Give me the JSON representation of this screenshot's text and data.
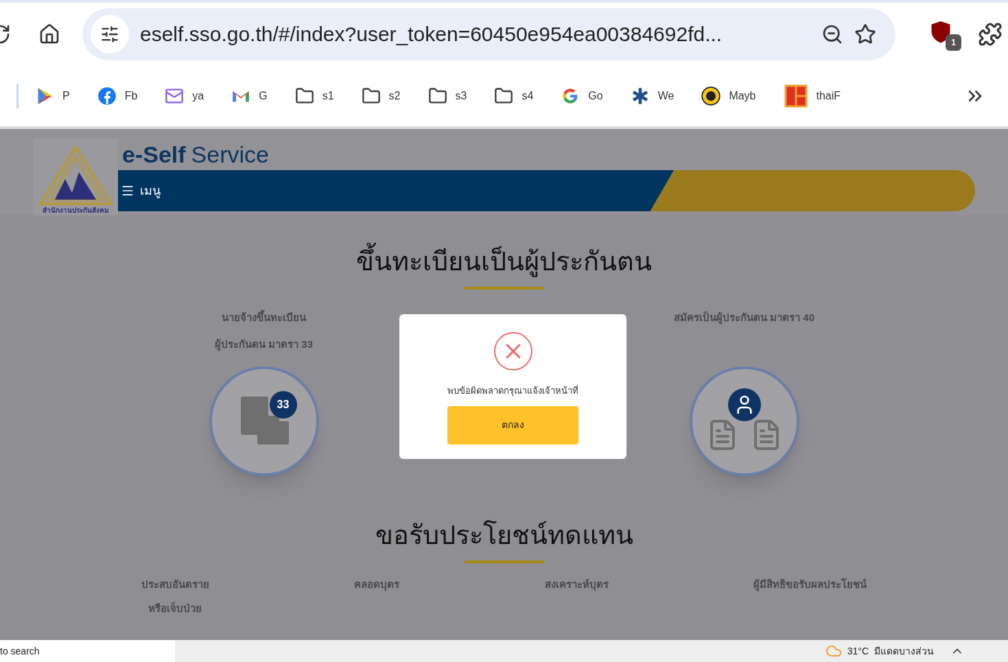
{
  "browser": {
    "url": "eself.sso.go.th/#/index?user_token=60450e954ea00384692fd...",
    "extension_badge": "1"
  },
  "bookmarks": [
    {
      "label": "P",
      "kind": "play"
    },
    {
      "label": "Fb",
      "kind": "facebook"
    },
    {
      "label": "ya",
      "kind": "mail"
    },
    {
      "label": "G",
      "kind": "gmail"
    },
    {
      "label": "s1",
      "kind": "folder"
    },
    {
      "label": "s2",
      "kind": "folder"
    },
    {
      "label": "s3",
      "kind": "folder"
    },
    {
      "label": "s4",
      "kind": "folder"
    },
    {
      "label": "Go",
      "kind": "google"
    },
    {
      "label": "We",
      "kind": "star"
    },
    {
      "label": "Mayb",
      "kind": "coin"
    },
    {
      "label": "thaiF",
      "kind": "tile"
    }
  ],
  "site": {
    "logo_caption": "สำนักงานประกันสังคม",
    "brand_bold": "e-Self",
    "brand_light": "Service",
    "menu": "เมนู"
  },
  "sections": [
    {
      "title": "ขึ้นทะเบียนเป็นผู้ประกันตน",
      "cards": [
        {
          "lines": [
            "นายจ้างขึ้นทะเบียน",
            "ผู้ประกันตน มาตรา 33"
          ],
          "kind": "employer",
          "badge": "33"
        },
        {
          "lines": [
            "สมัครเป็นผู้ประกันตน มาตรา 40"
          ],
          "kind": "person"
        }
      ]
    },
    {
      "title": "ขอรับประโยชน์ทดแทน",
      "cards": [
        {
          "lines": [
            "ประสบอันตราย",
            "หรือเจ็บป่วย"
          ]
        },
        {
          "lines": [
            "คลอดบุตร"
          ]
        },
        {
          "lines": [
            "สงเคราะห์บุตร"
          ]
        },
        {
          "lines": [
            "ผู้มีสิทธิขอรับผลประโยชน์"
          ]
        }
      ]
    }
  ],
  "dialog": {
    "message": "พบข้อผิดพลาดกรุณาแจ้งเจ้าหน้าที่",
    "button": "ตกลง"
  },
  "taskbar": {
    "search": "to search",
    "temperature": "31°C",
    "weather": "มีแดดบางส่วน"
  }
}
